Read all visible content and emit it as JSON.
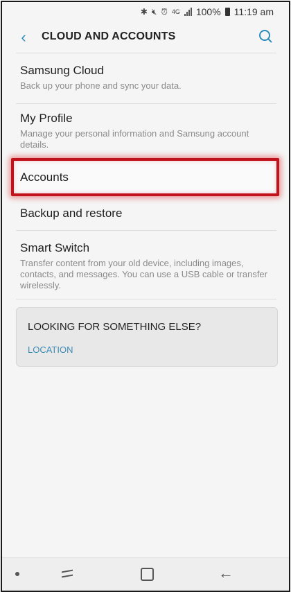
{
  "status_bar": {
    "icons": [
      "bluetooth-icon",
      "mute-icon",
      "alarm-icon",
      "4g-icon",
      "signal-icon"
    ],
    "network": "4G",
    "battery": "100%",
    "time": "11:19 am"
  },
  "header": {
    "title": "CLOUD AND ACCOUNTS",
    "back_icon": "chevron-left-icon",
    "search_icon": "search-icon",
    "accent_color": "#2e8bb8"
  },
  "items": [
    {
      "title": "Samsung Cloud",
      "subtitle": "Back up your phone and sync your data."
    },
    {
      "title": "My Profile",
      "subtitle": "Manage your personal information and Samsung account details."
    },
    {
      "title": "Accounts",
      "subtitle": ""
    },
    {
      "title": "Backup and restore",
      "subtitle": ""
    },
    {
      "title": "Smart Switch",
      "subtitle": "Transfer content from your old device, including images, contacts, and messages. You can use a USB cable or transfer wirelessly."
    }
  ],
  "highlight": {
    "target": "Accounts",
    "color": "#c0131c"
  },
  "suggestion_card": {
    "heading": "LOOKING FOR SOMETHING ELSE?",
    "link": "LOCATION"
  },
  "nav_bar": {
    "icons": [
      "dot-icon",
      "recent-apps-icon",
      "home-icon",
      "back-arrow-icon"
    ]
  }
}
